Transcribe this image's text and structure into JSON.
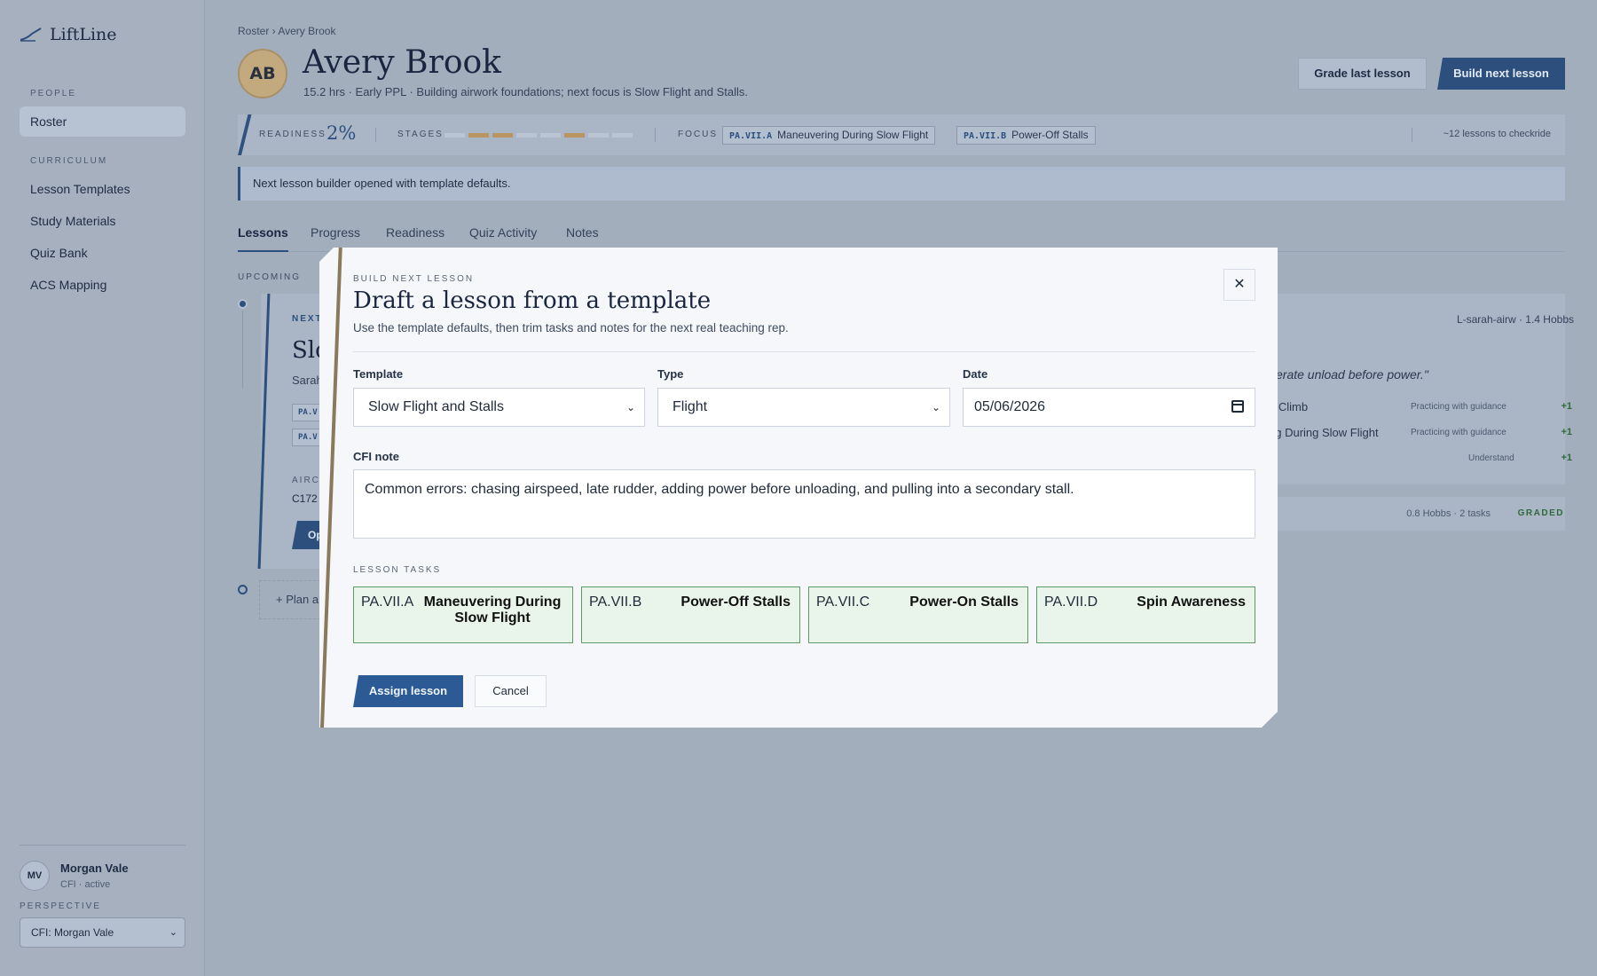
{
  "app": {
    "name": "LiftLine"
  },
  "sidebar": {
    "sections": [
      "PEOPLE",
      "CURRICULUM"
    ],
    "items": [
      {
        "label": "Roster",
        "active": true
      },
      {
        "label": "Lesson Templates"
      },
      {
        "label": "Study Materials"
      },
      {
        "label": "Quiz Bank"
      },
      {
        "label": "ACS Mapping"
      }
    ],
    "user": {
      "initials": "MV",
      "name": "Morgan Vale",
      "role": "CFI · active"
    },
    "perspective_label": "PERSPECTIVE",
    "perspective_value": "CFI: Morgan Vale"
  },
  "header": {
    "breadcrumb": "Roster › Avery Brook",
    "initials": "AB",
    "name": "Avery Brook",
    "subtitle": "15.2 hrs · Early PPL · Building airwork foundations; next focus is Slow Flight and Stalls.",
    "grade_button": "Grade last lesson",
    "build_button": "Build next lesson"
  },
  "stats": {
    "readiness_label": "READINESS",
    "readiness_value": "2%",
    "stages_label": "STAGES",
    "stages_done": [
      false,
      true,
      true,
      false,
      false,
      true,
      false,
      false
    ],
    "focus_label": "FOCUS",
    "focus": [
      {
        "code": "PA.VII.A",
        "name": "Maneuvering During Slow Flight"
      },
      {
        "code": "PA.VII.B",
        "name": "Power-Off Stalls"
      }
    ],
    "checkride": "~12 lessons to checkride"
  },
  "notice": "Next lesson builder opened with template defaults.",
  "tabs": [
    "Lessons",
    "Progress",
    "Readiness",
    "Quiz Activity",
    "Notes"
  ],
  "lessons": {
    "upcoming_label": "UPCOMING",
    "next_kicker": "NEXT",
    "next_title": "Slo",
    "next_meta": "Sarah",
    "mini_chips": [
      "PA.V",
      "PA.V"
    ],
    "aircraft_label": "AIRCR",
    "aircraft_value": "C172",
    "open_button": "Op",
    "plan_button": "+ Plan a",
    "right_meta": "L-sarah-airw · 1.4 Hobbs",
    "right_quote": "erate unload before power.\"",
    "right_tasks": [
      {
        "name": "d Climb",
        "status": "Practicing with guidance",
        "delta": "+1"
      },
      {
        "name": "ng During Slow Flight",
        "status": "Practicing with guidance",
        "delta": "+1"
      },
      {
        "name": "",
        "status": "Understand",
        "delta": "+1"
      }
    ],
    "graded_meta": "0.8 Hobbs · 2 tasks",
    "graded_label": "GRADED"
  },
  "modal": {
    "kicker": "BUILD NEXT LESSON",
    "title": "Draft a lesson from a template",
    "subtitle": "Use the template defaults, then trim tasks and notes for the next real teaching rep.",
    "template_label": "Template",
    "template_value": "Slow Flight and Stalls",
    "type_label": "Type",
    "type_value": "Flight",
    "date_label": "Date",
    "date_value": "05/06/2026",
    "note_label": "CFI note",
    "note_value": "Common errors: chasing airspeed, late rudder, adding power before unloading, and pulling into a secondary stall.",
    "tasks_label": "LESSON TASKS",
    "tasks": [
      {
        "code": "PA.VII.A",
        "name": "Maneuvering During Slow Flight"
      },
      {
        "code": "PA.VII.B",
        "name": "Power-Off Stalls"
      },
      {
        "code": "PA.VII.C",
        "name": "Power-On Stalls"
      },
      {
        "code": "PA.VII.D",
        "name": "Spin Awareness"
      }
    ],
    "assign_button": "Assign lesson",
    "cancel_button": "Cancel"
  }
}
